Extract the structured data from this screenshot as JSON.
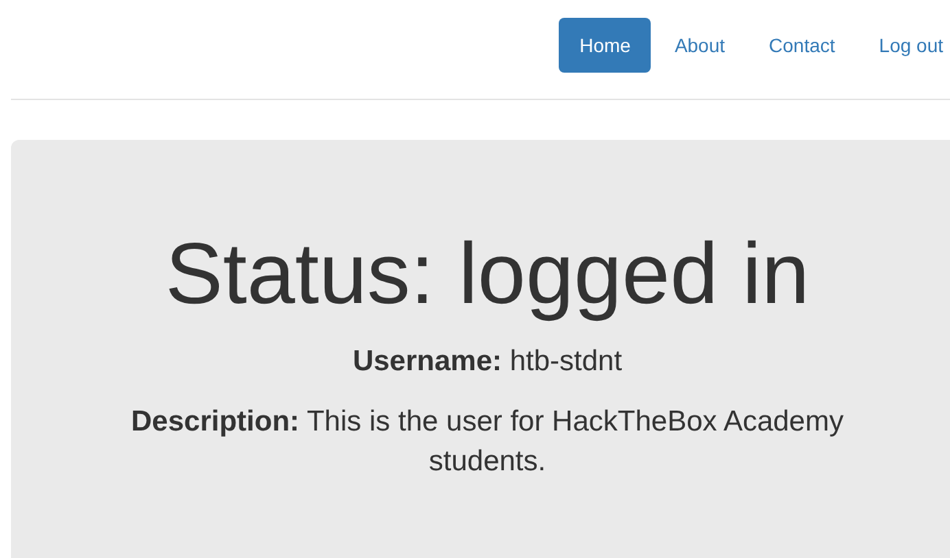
{
  "nav": [
    {
      "label": "Home",
      "selected": true
    },
    {
      "label": "About",
      "selected": false
    },
    {
      "label": "Contact",
      "selected": false
    },
    {
      "label": "Log out",
      "selected": false
    }
  ],
  "status": {
    "heading": "Status: logged in",
    "fields": [
      {
        "label": "Username:",
        "value": "htb-stdnt"
      },
      {
        "label": "Description:",
        "value": "This is the user for HackTheBox Academy students."
      }
    ]
  }
}
